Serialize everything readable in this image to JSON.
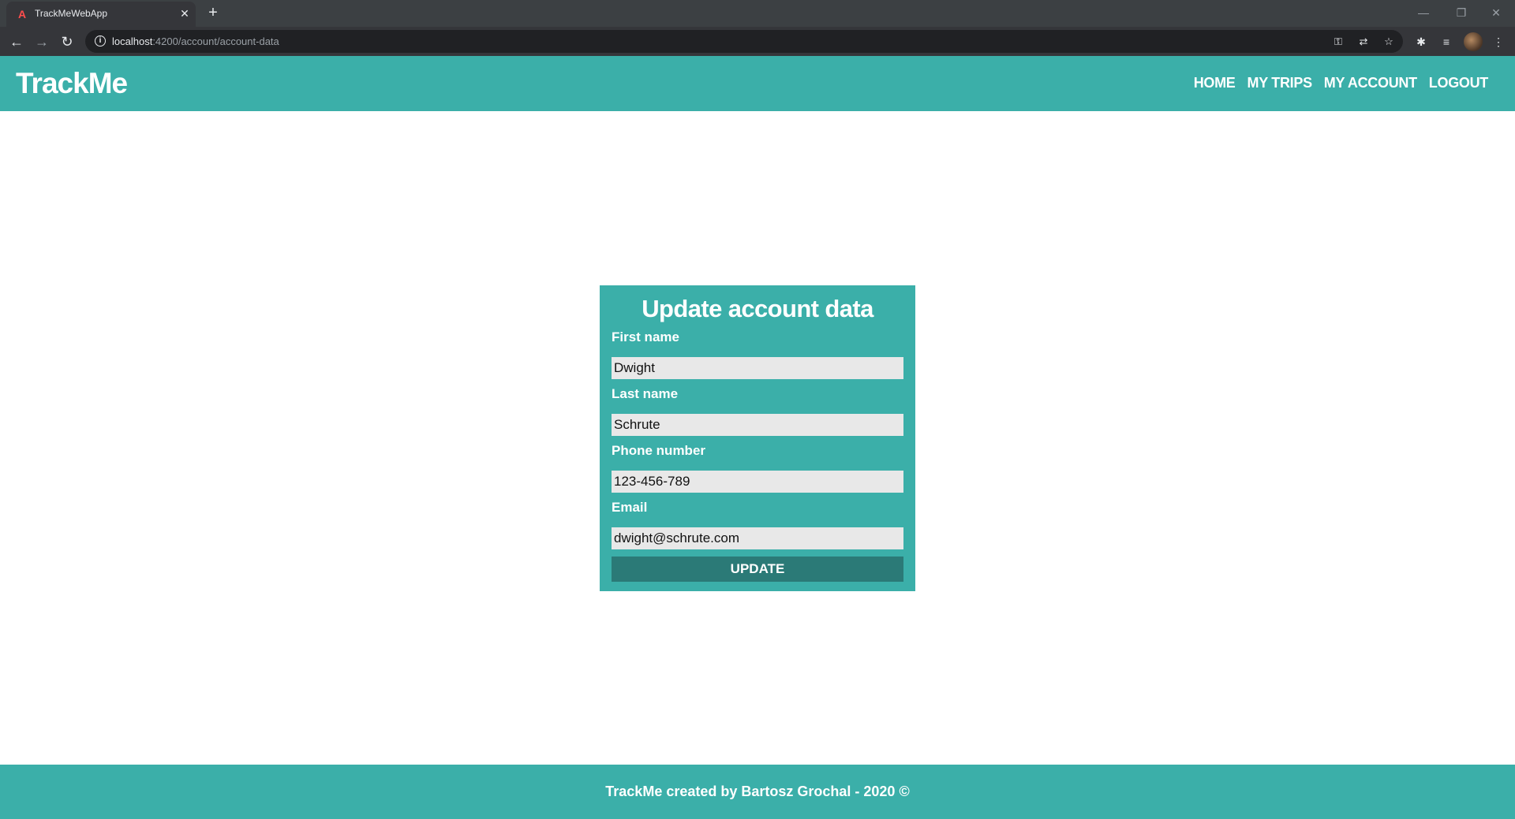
{
  "browser": {
    "tab_title": "TrackMeWebApp",
    "tab_favicon": "A",
    "url_host": "localhost",
    "url_path": ":4200/account/account-data"
  },
  "header": {
    "logo": "TrackMe",
    "nav": [
      "HOME",
      "MY TRIPS",
      "MY ACCOUNT",
      "LOGOUT"
    ]
  },
  "form": {
    "title": "Update account data",
    "fields": [
      {
        "label": "First name",
        "value": "Dwight"
      },
      {
        "label": "Last name",
        "value": "Schrute"
      },
      {
        "label": "Phone number",
        "value": "123-456-789"
      },
      {
        "label": "Email",
        "value": "dwight@schrute.com"
      }
    ],
    "submit_label": "UPDATE"
  },
  "footer": {
    "text": "TrackMe created by Bartosz Grochal - 2020 ©"
  },
  "colors": {
    "brand": "#3bafa9",
    "button": "#2b7a77"
  }
}
